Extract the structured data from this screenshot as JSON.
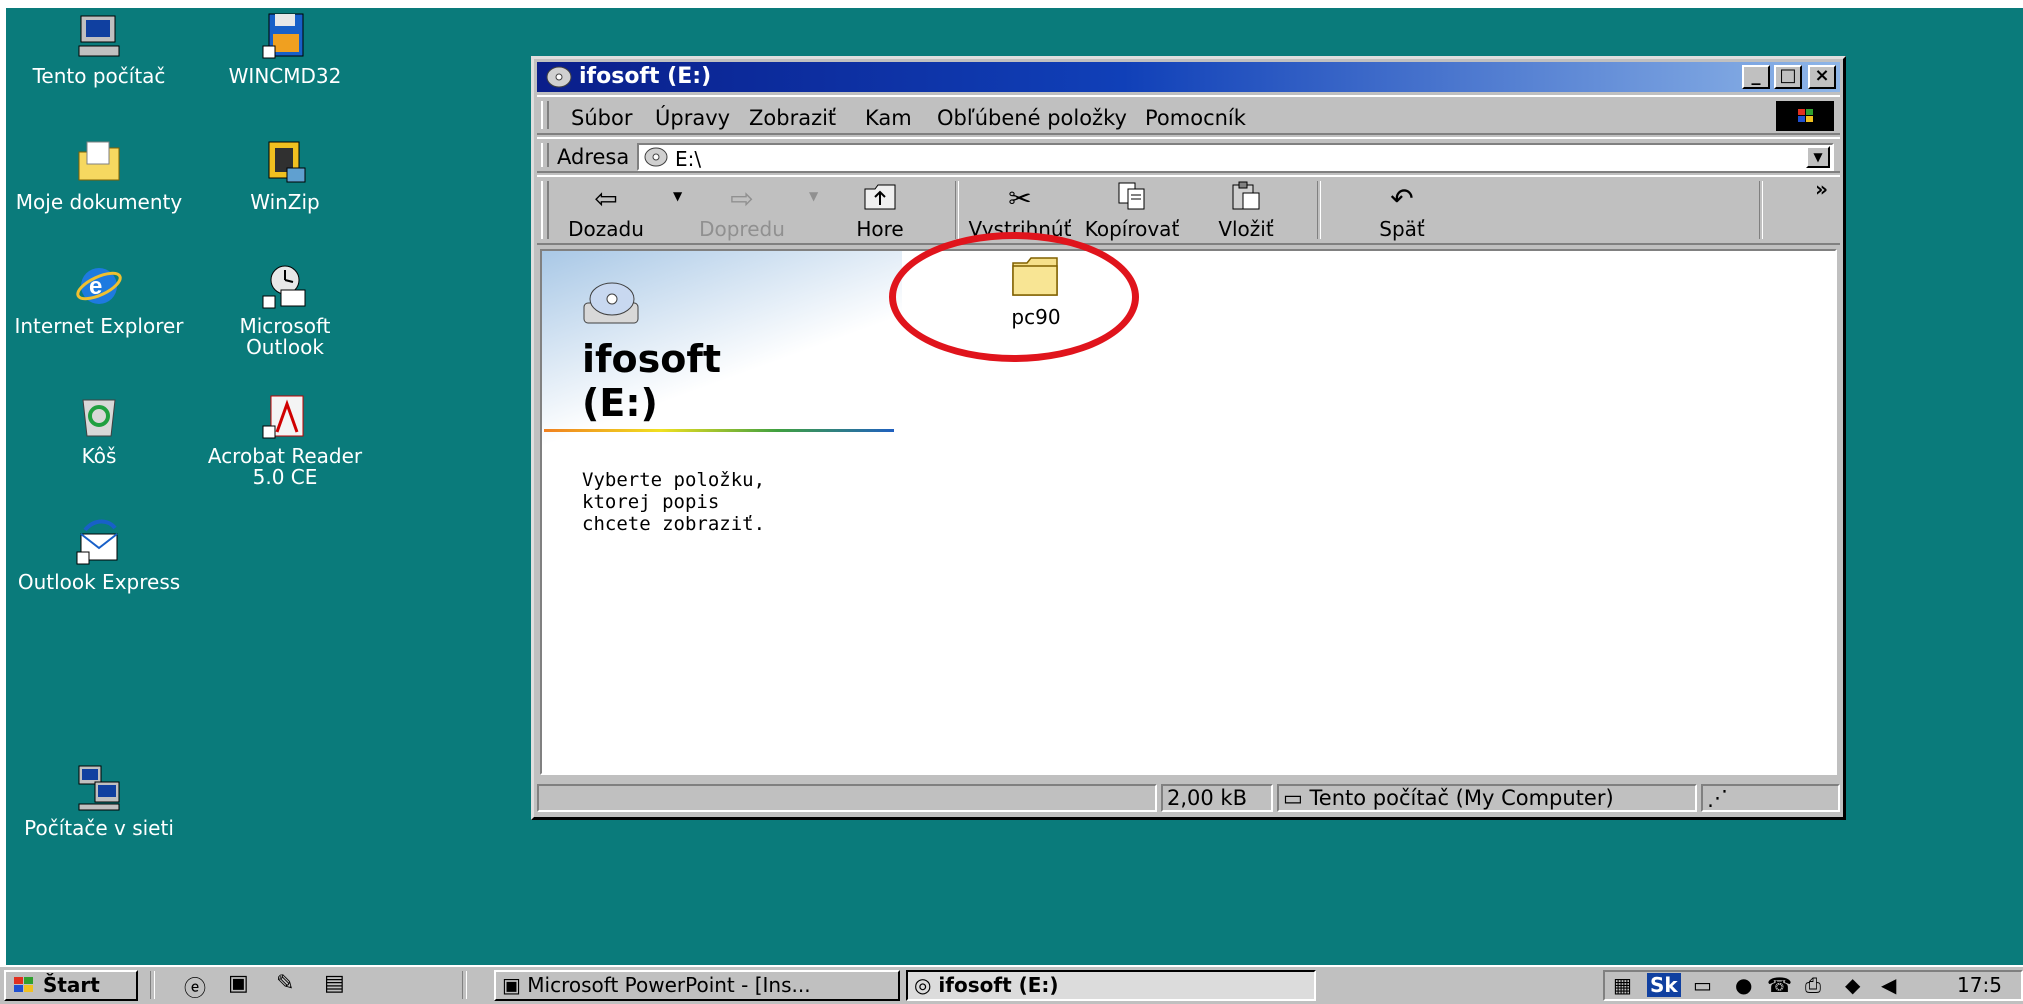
{
  "desktop": {
    "icons": [
      {
        "label": "Tento počítač",
        "icon": "my-computer-icon"
      },
      {
        "label": "WINCMD32",
        "icon": "wincmd-icon"
      },
      {
        "label": "Moje dokumenty",
        "icon": "my-documents-icon"
      },
      {
        "label": "WinZip",
        "icon": "winzip-icon"
      },
      {
        "label": "Internet Explorer",
        "icon": "internet-explorer-icon"
      },
      {
        "label": "Microsoft Outlook",
        "icon": "outlook-icon"
      },
      {
        "label": "Kôš",
        "icon": "recycle-bin-icon"
      },
      {
        "label": "Acrobat Reader 5.0 CE",
        "icon": "acrobat-icon"
      },
      {
        "label": "Outlook Express",
        "icon": "outlook-express-icon"
      },
      {
        "label": "Počítače v sieti",
        "icon": "network-icon"
      }
    ]
  },
  "window": {
    "title": "ifosoft (E:)",
    "controls": [
      "minimize",
      "maximize",
      "close"
    ],
    "menu": [
      {
        "label": "Súbor"
      },
      {
        "label": "Úpravy"
      },
      {
        "label": "Zobraziť"
      },
      {
        "label": "Kam"
      },
      {
        "label": "Obľúbené položky"
      },
      {
        "label": "Pomocník"
      }
    ],
    "address": {
      "label": "Adresa",
      "value": "E:\\"
    },
    "toolbar": [
      {
        "label": "Dozadu",
        "icon": "back-arrow-icon",
        "enabled": true
      },
      {
        "label": "Dopredu",
        "icon": "forward-arrow-icon",
        "enabled": false
      },
      {
        "label": "Hore",
        "icon": "up-folder-icon",
        "enabled": true
      },
      {
        "label": "Vystrihnúť",
        "icon": "scissors-icon",
        "enabled": true
      },
      {
        "label": "Kopírovať",
        "icon": "copy-icon",
        "enabled": true
      },
      {
        "label": "Vložiť",
        "icon": "paste-icon",
        "enabled": true
      },
      {
        "label": "Späť",
        "icon": "undo-icon",
        "enabled": true
      }
    ],
    "toolbar_more": "»",
    "left_pane": {
      "title_line1": "ifosoft",
      "title_line2": "(E:)",
      "description": "Vyberte položku,\nktorej popis\nchcete zobraziť."
    },
    "files": [
      {
        "name": "pc90",
        "type": "folder",
        "highlighted": true
      }
    ],
    "status": {
      "size": "2,00 kB",
      "location": "Tento počítač (My Computer)"
    }
  },
  "taskbar": {
    "start_label": "Štart",
    "tasks": [
      {
        "label": "Microsoft PowerPoint - [Ins...",
        "active": false
      },
      {
        "label": "ifosoft (E:)",
        "active": true
      }
    ],
    "tray": {
      "lang": "Sk",
      "clock": "17:5"
    }
  },
  "colors": {
    "desktop": "#0a7b7b",
    "titlebar": "#0a1e8a",
    "highlight_circle": "#e0141c"
  }
}
